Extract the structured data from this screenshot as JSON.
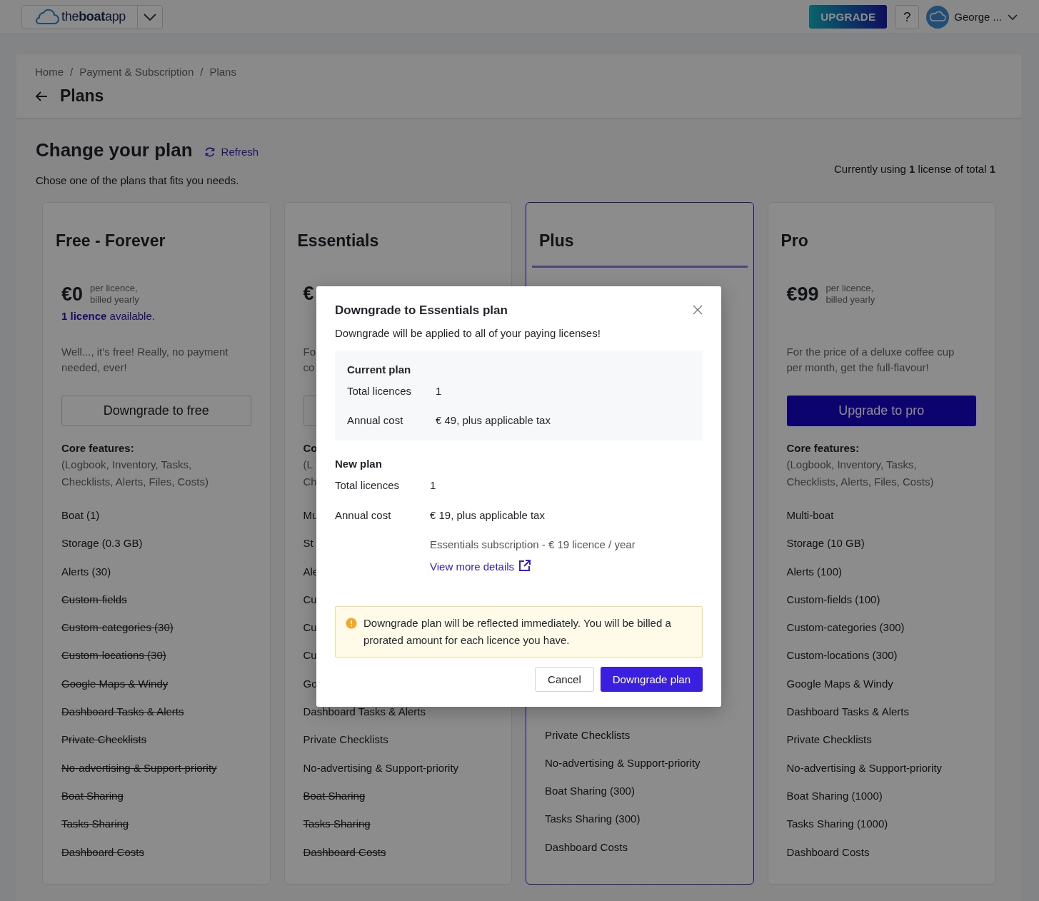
{
  "top_bar": {
    "logo": "the**boat**app",
    "upgrade_button": "UPGRADE",
    "help_button": "?",
    "user_name": "George ..."
  },
  "header": {
    "breadcrumb": [
      "Home",
      "Payment & Subscription",
      "Plans"
    ],
    "separator": "/",
    "title": "Plans"
  },
  "intro": {
    "title": "Change your plan",
    "refresh": "Refresh",
    "usage": "Currently using **1** license of total **1**",
    "subtitle": "Chose one of the plans that fits you needs."
  },
  "plans": [
    {
      "name": "Free - Forever",
      "selected": false,
      "price": "€0",
      "price_note": "per licence, billed yearly",
      "availability": "**1 licence** available.",
      "description_lines": [
        "Well..., it’s free! Really, no payment",
        "needed, ever!"
      ],
      "button": {
        "label": "Downgrade to free",
        "kind": "outline"
      },
      "core_title": "Core features:",
      "core_lines": [
        "(Logbook, Inventory, Tasks,",
        "Checklists, Alerts, Files, Costs)"
      ],
      "features": [
        {
          "text": "Boat (1)",
          "available": true
        },
        {
          "text": "Storage (0.3 GB)",
          "available": true
        },
        {
          "text": "Alerts (30)",
          "available": true
        },
        {
          "text": "Custom-fields",
          "available": false
        },
        {
          "text": "Custom-categories (30)",
          "available": false
        },
        {
          "text": "Custom-locations (30)",
          "available": false
        },
        {
          "text": "Google Maps & Windy",
          "available": false
        },
        {
          "text": "Dashboard Tasks & Alerts",
          "available": false
        },
        {
          "text": "Private Checklists",
          "available": false
        },
        {
          "text": "No-advertising & Support-priority",
          "available": false
        },
        {
          "text": "Boat Sharing",
          "available": false
        },
        {
          "text": "Tasks Sharing",
          "available": false
        },
        {
          "text": "Dashboard Costs",
          "available": false
        }
      ]
    },
    {
      "name": "Essentials",
      "selected": false,
      "price": "€",
      "description_lines": [
        "Fo",
        "co"
      ],
      "button": {
        "kind": "outline"
      },
      "core_title": "Co",
      "core_lines": [
        "(L",
        "Ch"
      ],
      "features": [
        {
          "text": "Mu",
          "available": true
        },
        {
          "text": "St",
          "available": true
        },
        {
          "text": "Ale",
          "available": true
        },
        {
          "text": "Cu",
          "available": true
        },
        {
          "text": "Cu",
          "available": true
        },
        {
          "text": "Cu",
          "available": true
        },
        {
          "text": "Go",
          "available": true
        },
        {
          "text": "Dashboard Tasks & Alerts",
          "available": true
        },
        {
          "text": "Private Checklists",
          "available": true
        },
        {
          "text": "No-advertising & Support-priority",
          "available": true
        },
        {
          "text": "Boat Sharing",
          "available": false
        },
        {
          "text": "Tasks Sharing",
          "available": false
        },
        {
          "text": "Dashboard Costs",
          "available": false
        }
      ]
    },
    {
      "name": "Plus",
      "selected": true,
      "features": [
        {
          "text": "Private Checklists",
          "available": true
        },
        {
          "text": "No-advertising & Support-priority",
          "available": true
        },
        {
          "text": "Boat Sharing (300)",
          "available": true
        },
        {
          "text": "Tasks Sharing (300)",
          "available": true
        },
        {
          "text": "Dashboard Costs",
          "available": true
        }
      ]
    },
    {
      "name": "Pro",
      "selected": false,
      "price": "€99",
      "price_note": "per licence, billed yearly",
      "description_lines": [
        "For the price of a deluxe coffee cup",
        "per month, get the full-flavour!"
      ],
      "button": {
        "label": "Upgrade to pro",
        "kind": "primary"
      },
      "core_title": "Core features:",
      "core_lines": [
        "(Logbook, Inventory, Tasks,",
        "Checklists, Alerts, Files, Costs)"
      ],
      "features": [
        {
          "text": "Multi-boat",
          "available": true
        },
        {
          "text": "Storage (10 GB)",
          "available": true
        },
        {
          "text": "Alerts (100)",
          "available": true
        },
        {
          "text": "Custom-fields (100)",
          "available": true
        },
        {
          "text": "Custom-categories (300)",
          "available": true
        },
        {
          "text": "Custom-locations (300)",
          "available": true
        },
        {
          "text": "Google Maps & Windy",
          "available": true
        },
        {
          "text": "Dashboard Tasks & Alerts",
          "available": true
        },
        {
          "text": "Private Checklists",
          "available": true
        },
        {
          "text": "No-advertising & Support-priority",
          "available": true
        },
        {
          "text": "Boat Sharing (1000)",
          "available": true
        },
        {
          "text": "Tasks Sharing (1000)",
          "available": true
        },
        {
          "text": "Dashboard Costs",
          "available": true
        }
      ]
    }
  ],
  "modal": {
    "title": "Downgrade to Essentials plan",
    "subtitle": "Downgrade will be applied to all of your paying licenses!",
    "current_plan": {
      "heading": "Current plan",
      "rows": [
        {
          "label": "Total licences",
          "value": "1"
        },
        {
          "label": "Annual cost",
          "value": "€ 49, plus applicable tax"
        }
      ]
    },
    "new_plan": {
      "heading": "New plan",
      "rows": [
        {
          "label": "Total licences",
          "value": "1"
        },
        {
          "label": "Annual cost",
          "value": "€ 19, plus applicable tax"
        }
      ],
      "note": "Essentials subscription - € 19 licence / year",
      "link": "View more details"
    },
    "alert": "Downgrade plan will be reflected immediately. You will be billed a prorated amount for each licence you have.",
    "buttons": [
      {
        "label": "Cancel",
        "kind": "secondary"
      },
      {
        "label": "Downgrade plan",
        "kind": "primary"
      }
    ]
  }
}
